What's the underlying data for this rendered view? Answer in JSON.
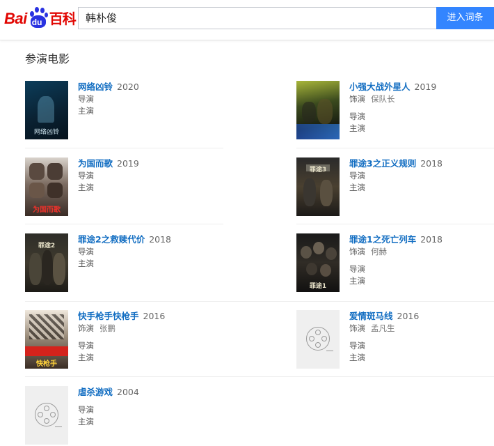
{
  "header": {
    "logo": {
      "bai": "Bai",
      "du": "du",
      "baike": "百科"
    },
    "search_value": "韩朴俊",
    "search_button": "进入词条"
  },
  "section": {
    "title": "参演电影",
    "movies": [
      {
        "title": "网络凶铃",
        "year": "2020",
        "role_label": "",
        "role_value": "",
        "director_label": "导演",
        "actor_label": "主演",
        "poster_text": "网络凶铃"
      },
      {
        "title": "小强大战外星人",
        "year": "2019",
        "role_label": "饰演",
        "role_value": "保队长",
        "director_label": "导演",
        "actor_label": "主演",
        "poster_text": ""
      },
      {
        "title": "为国而歌",
        "year": "2019",
        "role_label": "",
        "role_value": "",
        "director_label": "导演",
        "actor_label": "主演",
        "poster_text": "为国而歌"
      },
      {
        "title": "罪途3之正义规则",
        "year": "2018",
        "role_label": "",
        "role_value": "",
        "director_label": "导演",
        "actor_label": "主演",
        "poster_text": "罪途3"
      },
      {
        "title": "罪途2之救赎代价",
        "year": "2018",
        "role_label": "",
        "role_value": "",
        "director_label": "导演",
        "actor_label": "主演",
        "poster_text": "罪途2"
      },
      {
        "title": "罪途1之死亡列车",
        "year": "2018",
        "role_label": "饰演",
        "role_value": "何赫",
        "director_label": "导演",
        "actor_label": "主演",
        "poster_text": "罪途1"
      },
      {
        "title": "快手枪手快枪手",
        "year": "2016",
        "role_label": "饰演",
        "role_value": "张鹏",
        "director_label": "导演",
        "actor_label": "主演",
        "poster_text": "快枪手"
      },
      {
        "title": "爱情斑马线",
        "year": "2016",
        "role_label": "饰演",
        "role_value": "孟凡生",
        "director_label": "导演",
        "actor_label": "主演",
        "poster_text": ""
      },
      {
        "title": "虐杀游戏",
        "year": "2004",
        "role_label": "",
        "role_value": "",
        "director_label": "导演",
        "actor_label": "主演",
        "poster_text": ""
      }
    ]
  },
  "colors": {
    "brand_red": "#e10602",
    "brand_blue": "#2932e1",
    "button_blue": "#3385ff",
    "link_blue": "#136ec2"
  }
}
